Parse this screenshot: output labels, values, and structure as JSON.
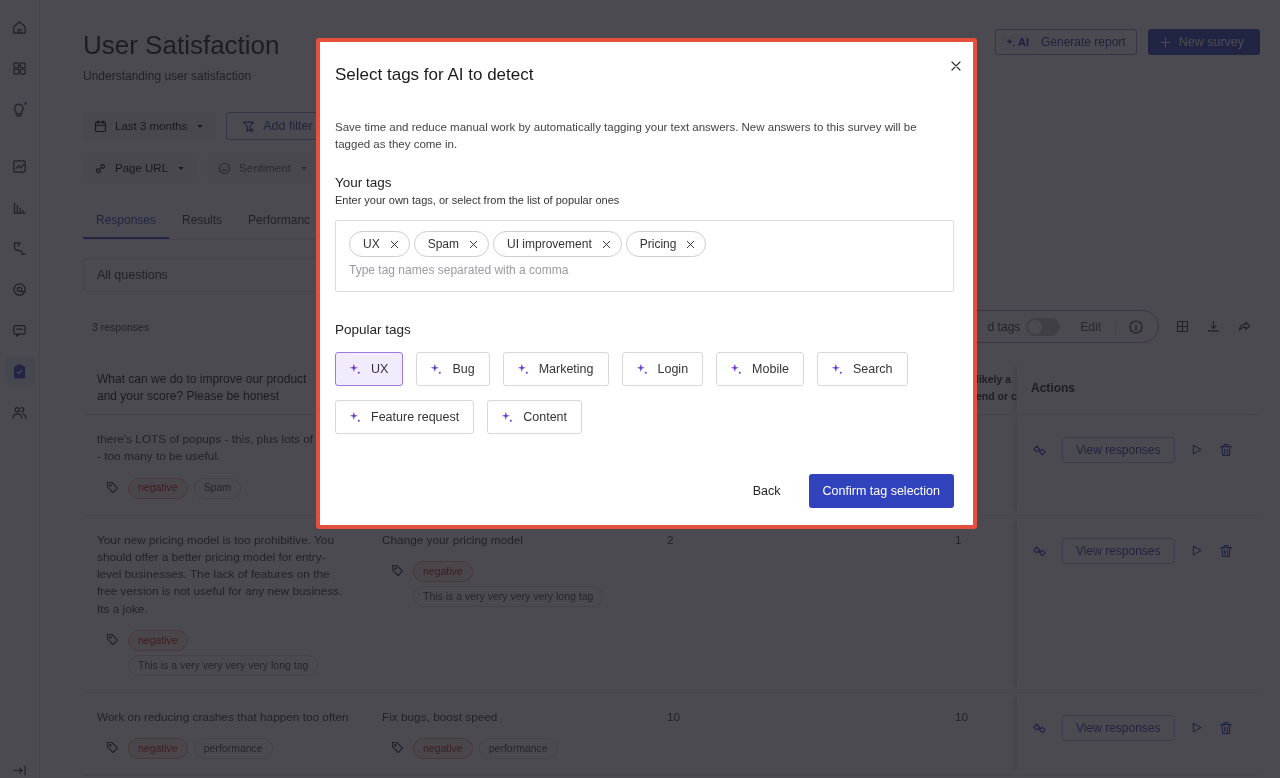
{
  "sidebar": {
    "items": [
      {
        "selected": false
      },
      {
        "selected": false
      },
      {
        "selected": false
      },
      {
        "selected": false
      },
      {
        "selected": false
      },
      {
        "selected": false
      },
      {
        "selected": false
      },
      {
        "selected": false
      },
      {
        "selected": true
      },
      {
        "selected": false
      }
    ]
  },
  "header": {
    "title": "User Satisfaction",
    "subtitle": "Understanding user satisfaction",
    "ai_badge": "AI",
    "report_button": "Generate report",
    "new_button": "New survey"
  },
  "filter_rows": [
    {
      "filters": [
        {
          "label": "Last 3 months",
          "kind": "date",
          "disabled": false
        },
        {
          "label": "Add filter",
          "kind": "add",
          "disabled": false
        }
      ]
    },
    {
      "filters": [
        {
          "label": "Page URL",
          "kind": "url",
          "disabled": false
        },
        {
          "label": "Sentiment",
          "kind": "sentiment",
          "disabled": true
        }
      ]
    }
  ],
  "tabs": [
    {
      "label": "Responses",
      "selected": true
    },
    {
      "label": "Results",
      "selected": false
    },
    {
      "label": "Performanc",
      "selected": false
    }
  ],
  "question_select": {
    "value": "All questions"
  },
  "response_count": "3 responses",
  "tag_toolbar": {
    "label": "d tags",
    "on": false,
    "edit": "Edit"
  },
  "table": {
    "header": {
      "column_1": "What can we do to improve our product and your score? Please be honest",
      "column_4": "likely a\nend or c",
      "actions": "Actions"
    },
    "rows": [
      {
        "cells": [
          {
            "kind": "answer",
            "text": "there's LOTS of popups - this, plus lots of\n- too many to be useful.",
            "tags": [
              {
                "label": "negative",
                "kind": "sentiment"
              },
              {
                "label": "Spam",
                "kind": "tag"
              }
            ]
          }
        ],
        "action": "View responses"
      },
      {
        "cells": [
          {
            "kind": "answer",
            "text": "Your new pricing model is too prohibitive. You should offer a better pricing model for entry-level businesses. The lack of features on the free version is not useful for any new business. Its a joke.",
            "tags": [
              {
                "label": "negative",
                "kind": "sentiment"
              },
              {
                "label": "This is a very very very very long tag",
                "kind": "tag"
              }
            ]
          },
          {
            "kind": "answer",
            "text": "Change your pricing model",
            "tags": [
              {
                "label": "negative",
                "kind": "sentiment"
              },
              {
                "label": "This is a very very very very long tag",
                "kind": "tag"
              }
            ]
          },
          {
            "kind": "number",
            "text": "2"
          },
          {
            "kind": "number",
            "text": "1"
          }
        ],
        "action": "View responses"
      },
      {
        "cells": [
          {
            "kind": "answer",
            "text": "Work on reducing crashes that happen too often",
            "tags": [
              {
                "label": "negative",
                "kind": "sentiment"
              },
              {
                "label": "performance",
                "kind": "tag"
              }
            ]
          },
          {
            "kind": "answer",
            "text": "Fix bugs, boost speed",
            "tags": [
              {
                "label": "negative",
                "kind": "sentiment"
              },
              {
                "label": "performance",
                "kind": "tag"
              }
            ]
          },
          {
            "kind": "number",
            "text": "10"
          },
          {
            "kind": "number",
            "text": "10"
          }
        ],
        "action": "View responses"
      }
    ]
  },
  "modal": {
    "title": "Select tags for AI to detect",
    "description": "Save time and reduce manual work by automatically tagging your text answers. New answers to this survey will be tagged as they come in.",
    "your_tags": {
      "heading": "Your tags",
      "hint": "Enter your own tags, or select from the list of popular ones",
      "chips": [
        "UX",
        "Spam",
        "UI improvement",
        "Pricing"
      ],
      "placeholder": "Type tag names separated with a comma"
    },
    "popular_tags": {
      "heading": "Popular tags",
      "tags": [
        {
          "label": "UX",
          "selected": true
        },
        {
          "label": "Bug",
          "selected": false
        },
        {
          "label": "Marketing",
          "selected": false
        },
        {
          "label": "Login",
          "selected": false
        },
        {
          "label": "Mobile",
          "selected": false
        },
        {
          "label": "Search",
          "selected": false
        },
        {
          "label": "Feature request",
          "selected": false
        },
        {
          "label": "Content",
          "selected": false
        }
      ]
    },
    "back_button": "Back",
    "confirm_button": "Confirm tag selection"
  }
}
